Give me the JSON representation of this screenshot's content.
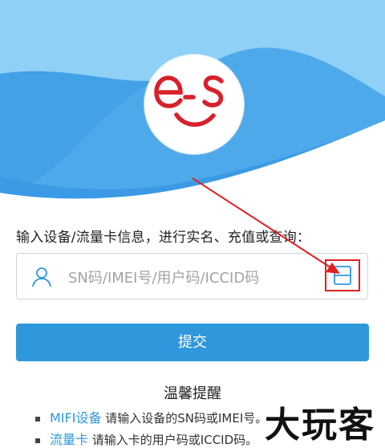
{
  "colors": {
    "brand": "#2f97dc",
    "hero_light": "#8fd0f6",
    "hero_mid": "#5fb6ef",
    "hero_dark": "#3a9ae5",
    "logo_red": "#d8202a",
    "annotation_red": "#e02020"
  },
  "logo": {
    "text": "e-s"
  },
  "form": {
    "prompt": "输入设备/流量卡信息，进行实名、充值或查询：",
    "placeholder": "SN码/IMEI号/用户码/ICCID码",
    "submit_label": "提交"
  },
  "tips": {
    "title": "温馨提醒",
    "items": [
      {
        "highlight": "MIFI设备",
        "text": "请输入设备的SN码或IMEI号。"
      },
      {
        "highlight": "流量卡",
        "text": "请输入卡的用户码或ICCID码。"
      }
    ]
  },
  "watermark": "大玩客"
}
